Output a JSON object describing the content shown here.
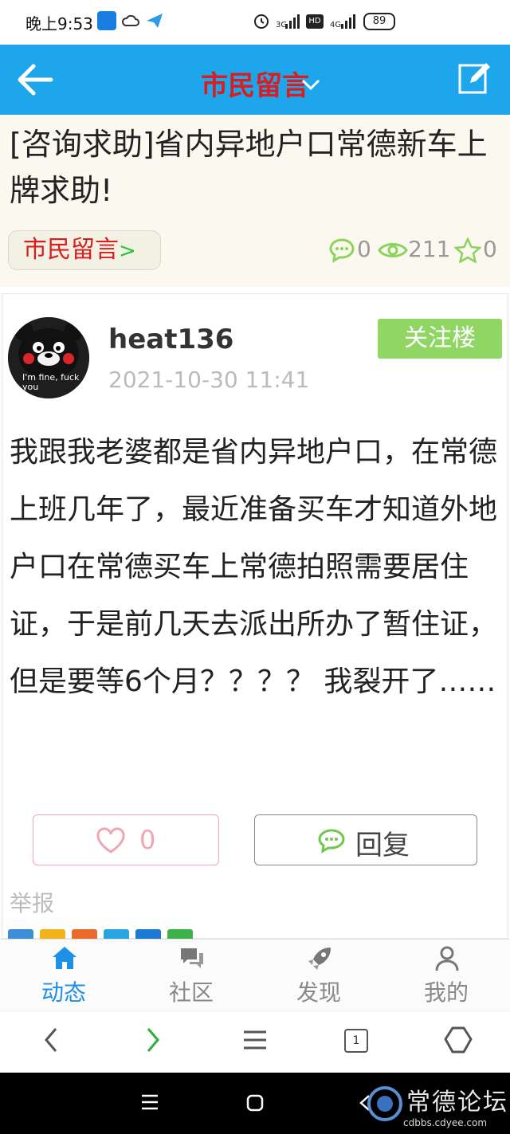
{
  "status_bar": {
    "time": "晚上9:53",
    "network_1": "3G",
    "hd": "HD",
    "network_2": "4G",
    "battery": "89"
  },
  "header": {
    "title": "市民留言",
    "back_icon": "arrow-left-icon",
    "dropdown_icon": "chevron-down-icon",
    "compose_icon": "edit-icon"
  },
  "topic": {
    "title": "[咨询求助]省内异地户口常德新车上牌求助!",
    "forum_tag": "市民留言",
    "forum_tag_arrow": ">",
    "replies": "0",
    "views": "211",
    "favorites": "0"
  },
  "post": {
    "username": "heat136",
    "timestamp": "2021-10-30 11:41",
    "follow_label": "关注楼",
    "avatar_caption": "I'm fine, fuck you",
    "content": "我跟我老婆都是省内异地户口，在常德上班几年了，最近准备买车才知道外地户口在常德买车上常德拍照需要居住证，于是前几天去派出所办了暂住证，但是要等6个月？？？？ 我裂开了……",
    "like_count": "0",
    "reply_label": "回复",
    "report_label": "举报"
  },
  "tabs": [
    {
      "label": "动态",
      "icon": "home-icon",
      "active": true
    },
    {
      "label": "社区",
      "icon": "chat-bubbles-icon",
      "active": false
    },
    {
      "label": "发现",
      "icon": "rocket-icon",
      "active": false
    },
    {
      "label": "我的",
      "icon": "person-icon",
      "active": false
    }
  ],
  "browser": {
    "tab_count": "1"
  },
  "watermark": {
    "text": "常德论坛",
    "url": "cdbbs.cdyee.com"
  },
  "colors": {
    "header_bg": "#1ea6ec",
    "title_red": "#d81e1e",
    "follow_green": "#8fd663",
    "like_pink": "#f2a5b0",
    "tab_active": "#1e90e8"
  }
}
